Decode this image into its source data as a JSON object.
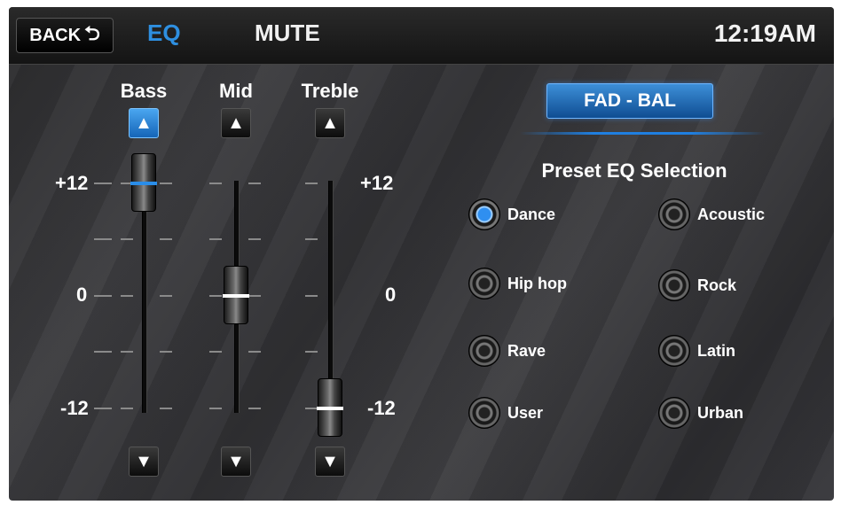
{
  "topbar": {
    "back_label": "BACK",
    "back_icon": "return-arrow-icon",
    "eq_label": "EQ",
    "mute_label": "MUTE",
    "clock": "12:19AM",
    "active_color": "#2e8fe0"
  },
  "sliders": {
    "bass": {
      "label": "Bass",
      "value": 12,
      "active": true
    },
    "mid": {
      "label": "Mid",
      "value": 0
    },
    "treble": {
      "label": "Treble",
      "value": -12
    },
    "scale": {
      "max": "+12",
      "mid": "0",
      "min": "-12"
    }
  },
  "fad_bal": {
    "label": "FAD - BAL"
  },
  "presets": {
    "title": "Preset EQ Selection",
    "selected": "Dance",
    "items": [
      "Dance",
      "Acoustic",
      "Hip hop",
      "Rock",
      "Rave",
      "Latin",
      "User",
      "Urban"
    ]
  }
}
